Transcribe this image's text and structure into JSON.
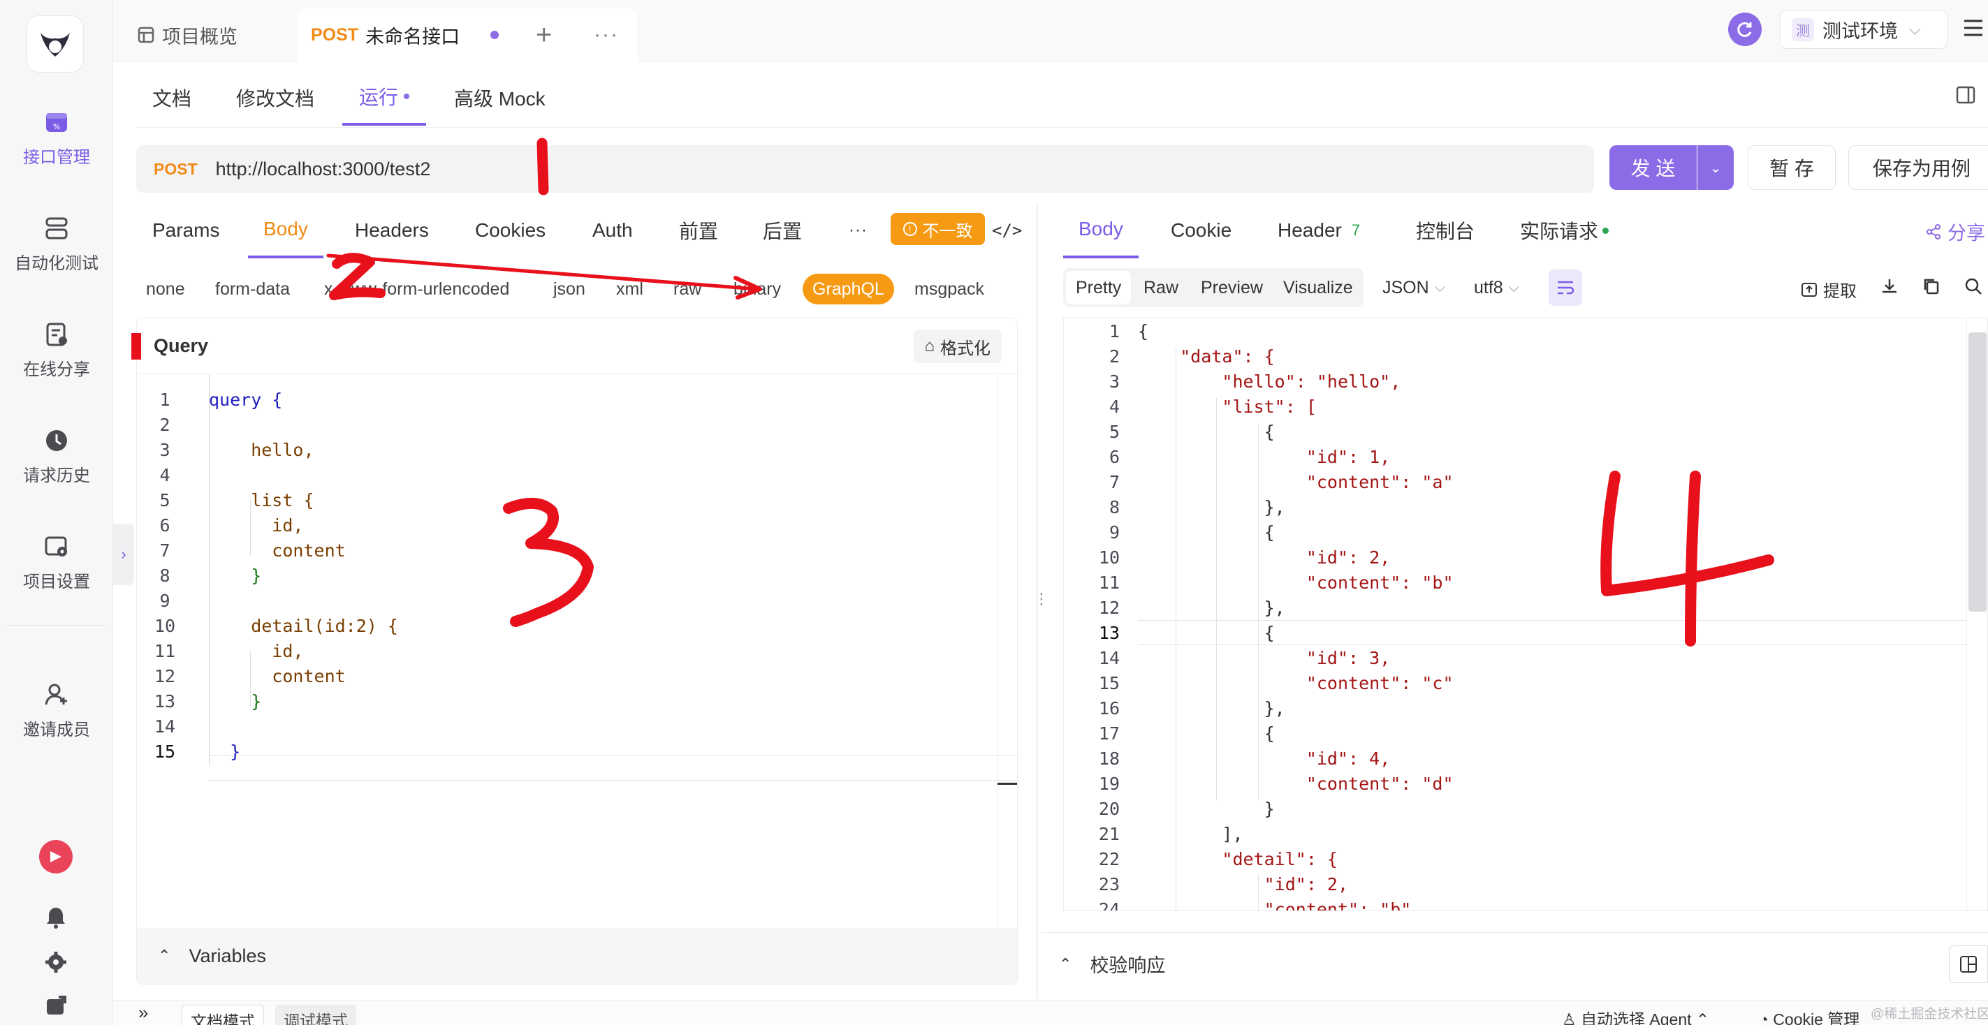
{
  "sidebar": {
    "items": [
      {
        "label": "接口管理",
        "icon": "api-icon",
        "active": true
      },
      {
        "label": "自动化测试",
        "icon": "automation-icon"
      },
      {
        "label": "在线分享",
        "icon": "share-doc-icon"
      },
      {
        "label": "请求历史",
        "icon": "history-icon"
      },
      {
        "label": "项目设置",
        "icon": "project-settings-icon"
      },
      {
        "label": "邀请成员",
        "icon": "invite-member-icon"
      }
    ]
  },
  "topbar": {
    "tab_overview": "项目概览",
    "tab_method": "POST",
    "tab_name": "未命名接口",
    "env_badge": "测",
    "env_name": "测试环境"
  },
  "subtabs": [
    "文档",
    "修改文档",
    "运行",
    "高级 Mock"
  ],
  "url": {
    "method": "POST",
    "value": "http://localhost:3000/test2",
    "send": "发 送",
    "save_temp": "暂 存",
    "save_case": "保存为用例"
  },
  "request": {
    "tabs": [
      "Params",
      "Body",
      "Headers",
      "Cookies",
      "Auth",
      "前置",
      "后置"
    ],
    "inconsistent": "不一致",
    "body_types": [
      "none",
      "form-data",
      "x-www-form-urlencoded",
      "json",
      "xml",
      "raw",
      "binary",
      "GraphQL",
      "msgpack"
    ],
    "query_title": "Query",
    "format_btn": "格式化",
    "variables": "Variables",
    "code": [
      {
        "n": "1",
        "t": "query {"
      },
      {
        "n": "2",
        "t": ""
      },
      {
        "n": "3",
        "t": "    hello,"
      },
      {
        "n": "4",
        "t": ""
      },
      {
        "n": "5",
        "t": "    list {"
      },
      {
        "n": "6",
        "t": "      id,"
      },
      {
        "n": "7",
        "t": "      content"
      },
      {
        "n": "8",
        "t": "    }"
      },
      {
        "n": "9",
        "t": ""
      },
      {
        "n": "10",
        "t": "    detail(id:2) {"
      },
      {
        "n": "11",
        "t": "      id,"
      },
      {
        "n": "12",
        "t": "      content"
      },
      {
        "n": "13",
        "t": "    }"
      },
      {
        "n": "14",
        "t": ""
      },
      {
        "n": "15",
        "t": "  }"
      }
    ]
  },
  "response": {
    "tabs": [
      "Body",
      "Cookie",
      "Header",
      "控制台",
      "实际请求"
    ],
    "header_count": "7",
    "share": "分享",
    "views": [
      "Pretty",
      "Raw",
      "Preview",
      "Visualize"
    ],
    "format": "JSON",
    "encoding": "utf8",
    "extract": "提取",
    "validate": "校验响应",
    "lines": [
      {
        "n": "1",
        "t": "{"
      },
      {
        "n": "2",
        "t": "    \"data\": {"
      },
      {
        "n": "3",
        "t": "        \"hello\": \"hello\","
      },
      {
        "n": "4",
        "t": "        \"list\": ["
      },
      {
        "n": "5",
        "t": "            {"
      },
      {
        "n": "6",
        "t": "                \"id\": 1,"
      },
      {
        "n": "7",
        "t": "                \"content\": \"a\""
      },
      {
        "n": "8",
        "t": "            },"
      },
      {
        "n": "9",
        "t": "            {"
      },
      {
        "n": "10",
        "t": "                \"id\": 2,"
      },
      {
        "n": "11",
        "t": "                \"content\": \"b\""
      },
      {
        "n": "12",
        "t": "            },"
      },
      {
        "n": "13",
        "t": "            {"
      },
      {
        "n": "14",
        "t": "                \"id\": 3,"
      },
      {
        "n": "15",
        "t": "                \"content\": \"c\""
      },
      {
        "n": "16",
        "t": "            },"
      },
      {
        "n": "17",
        "t": "            {"
      },
      {
        "n": "18",
        "t": "                \"id\": 4,"
      },
      {
        "n": "19",
        "t": "                \"content\": \"d\""
      },
      {
        "n": "20",
        "t": "            }"
      },
      {
        "n": "21",
        "t": "        ],"
      },
      {
        "n": "22",
        "t": "        \"detail\": {"
      },
      {
        "n": "23",
        "t": "            \"id\": 2,"
      },
      {
        "n": "24",
        "t": "            \"content\": \"b\""
      }
    ]
  },
  "bottombar": {
    "expand": "»",
    "doc_mode": "文档模式",
    "debug_mode": "调试模式",
    "agent": "自动选择 Agent",
    "cookie": "Cookie 管理",
    "watermark": "@稀土掘金技术社区"
  },
  "annotations": [
    "1",
    "2",
    "3",
    "4"
  ],
  "colors": {
    "accent": "#7b5ce6",
    "post": "#f28a15",
    "graphql": "#f59a12",
    "annotation": "#e8101b"
  }
}
